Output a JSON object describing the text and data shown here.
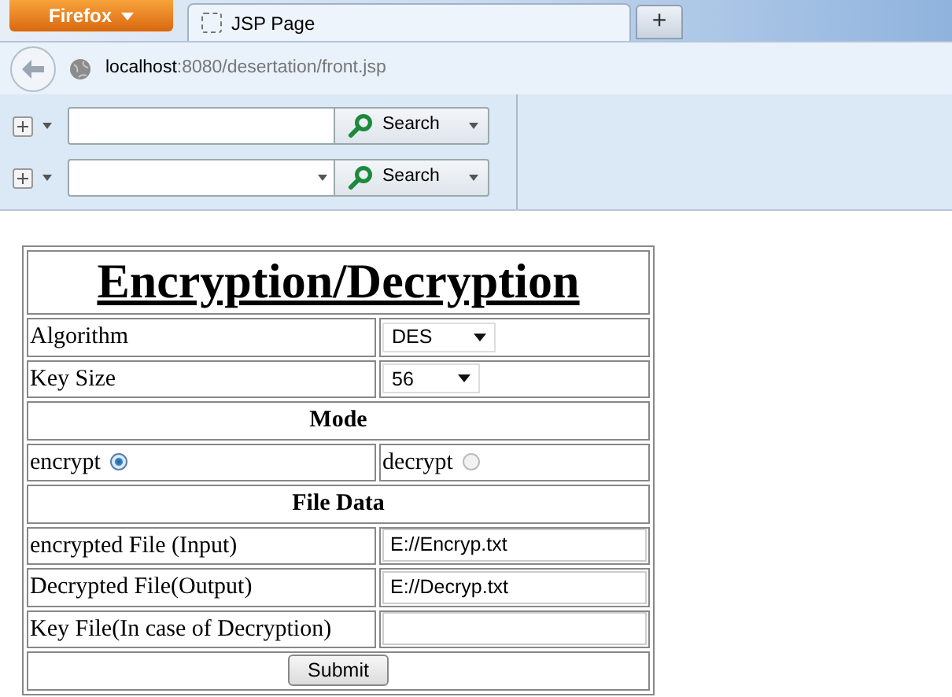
{
  "browser": {
    "menu_button": "Firefox",
    "tab": {
      "title": "JSP Page",
      "selected": true
    },
    "new_tab": "+",
    "address": {
      "host": "localhost",
      "rest": ":8080/desertation/front.jsp"
    },
    "search_bars": [
      {
        "dropdown": false,
        "button": "Search"
      },
      {
        "dropdown": true,
        "button": "Search"
      }
    ]
  },
  "form": {
    "title": "Encryption/Decryption",
    "rows": [
      {
        "kind": "select",
        "label": "Algorithm",
        "value": "DES"
      },
      {
        "kind": "select",
        "label": "Key Size",
        "value": "56"
      },
      {
        "kind": "section",
        "label": "Mode"
      },
      {
        "kind": "radios",
        "options": [
          {
            "label": "encrypt",
            "selected": true
          },
          {
            "label": "decrypt",
            "selected": false
          }
        ]
      },
      {
        "kind": "section",
        "label": "File Data"
      },
      {
        "kind": "text",
        "label": "encrypted File (Input)",
        "value": "E://Encryp.txt"
      },
      {
        "kind": "text",
        "label": "Decrypted File(Output)",
        "value": "E://Decryp.txt"
      },
      {
        "kind": "text",
        "label": "Key File(In case of Decryption)"
      },
      {
        "kind": "submit",
        "label": "Submit"
      }
    ]
  }
}
